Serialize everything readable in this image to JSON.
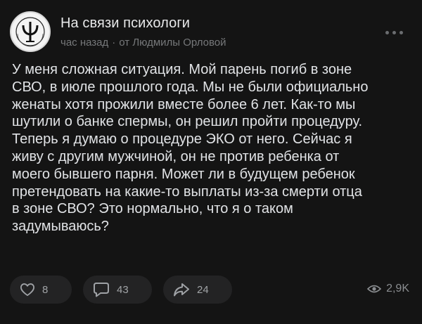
{
  "post": {
    "group_name": "На связи психологи",
    "time": "час назад",
    "separator": "·",
    "author": "от Людмилы Орловой",
    "text": "У меня сложная ситуация. Мой парень погиб в зоне\nСВО, в июле прошлого года. Мы не были официально\nженаты хотя прожили вместе более 6 лет. Как-то мы\nшутили о банке спермы, он решил пройти процедуру.\nТеперь я думаю о процедуре ЭКО от него. Сейчас я\nживу с другим мужчиной, он не против ребенка от\nмоего бывшего парня. Может ли в будущем ребенок\nпретендовать на какие-то выплаты из-за смерти отца\nв зоне СВО? Это нормально, что я о таком\nзадумываюсь?",
    "avatar_icon": "psychology-psi-logo-icon",
    "avatar_logo_text": "НА СВЯЗИ ПСИХОЛОГИ"
  },
  "actions": {
    "likes": "8",
    "comments": "43",
    "shares": "24",
    "views": "2,9K",
    "like_icon": "heart-icon",
    "comment_icon": "comment-icon",
    "share_icon": "share-arrow-icon",
    "views_icon": "eye-icon"
  },
  "colors": {
    "background": "#141414",
    "text": "#e1e3e6",
    "secondary_text": "#76787a",
    "pill_bg": "#232324"
  }
}
